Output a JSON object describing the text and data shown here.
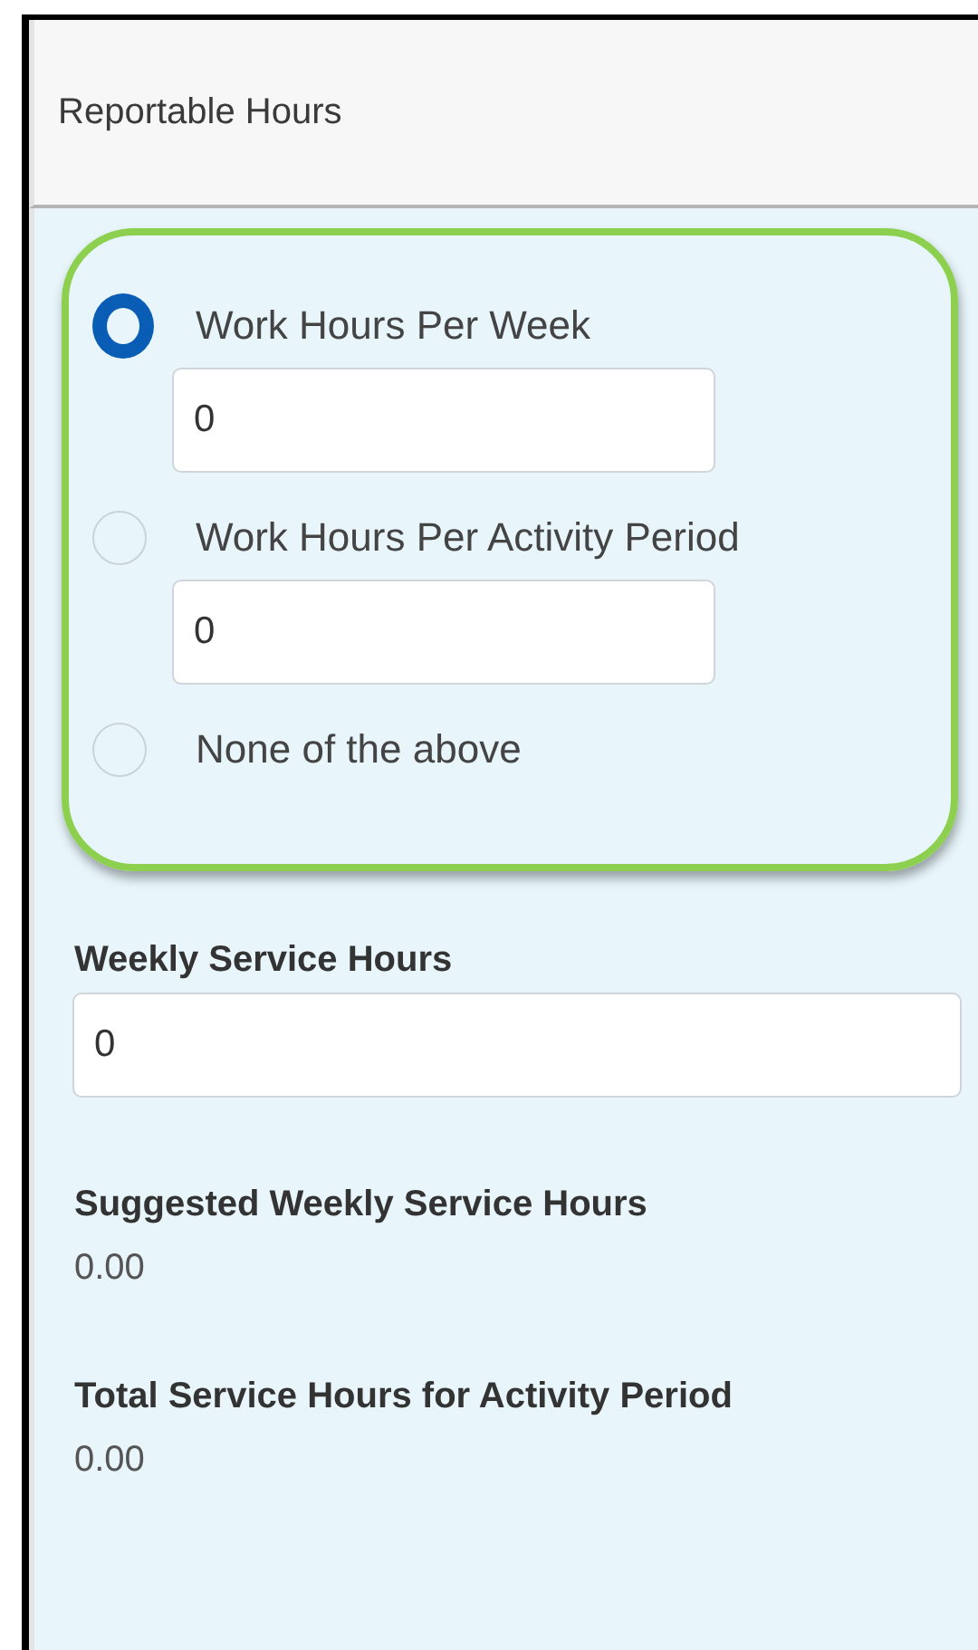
{
  "section": {
    "title": "Reportable Hours"
  },
  "options": [
    {
      "label": "Work Hours Per Week",
      "selected": true,
      "value": "0"
    },
    {
      "label": "Work Hours Per Activity Period",
      "selected": false,
      "value": "0"
    },
    {
      "label": "None of the above",
      "selected": false
    }
  ],
  "fields": [
    {
      "kind": "input",
      "label": "Weekly Service Hours",
      "value": "0"
    },
    {
      "kind": "readout",
      "label": "Suggested Weekly Service Hours",
      "value": "0.00"
    },
    {
      "kind": "readout",
      "label": "Total Service Hours for Activity Period",
      "value": "0.00"
    }
  ]
}
